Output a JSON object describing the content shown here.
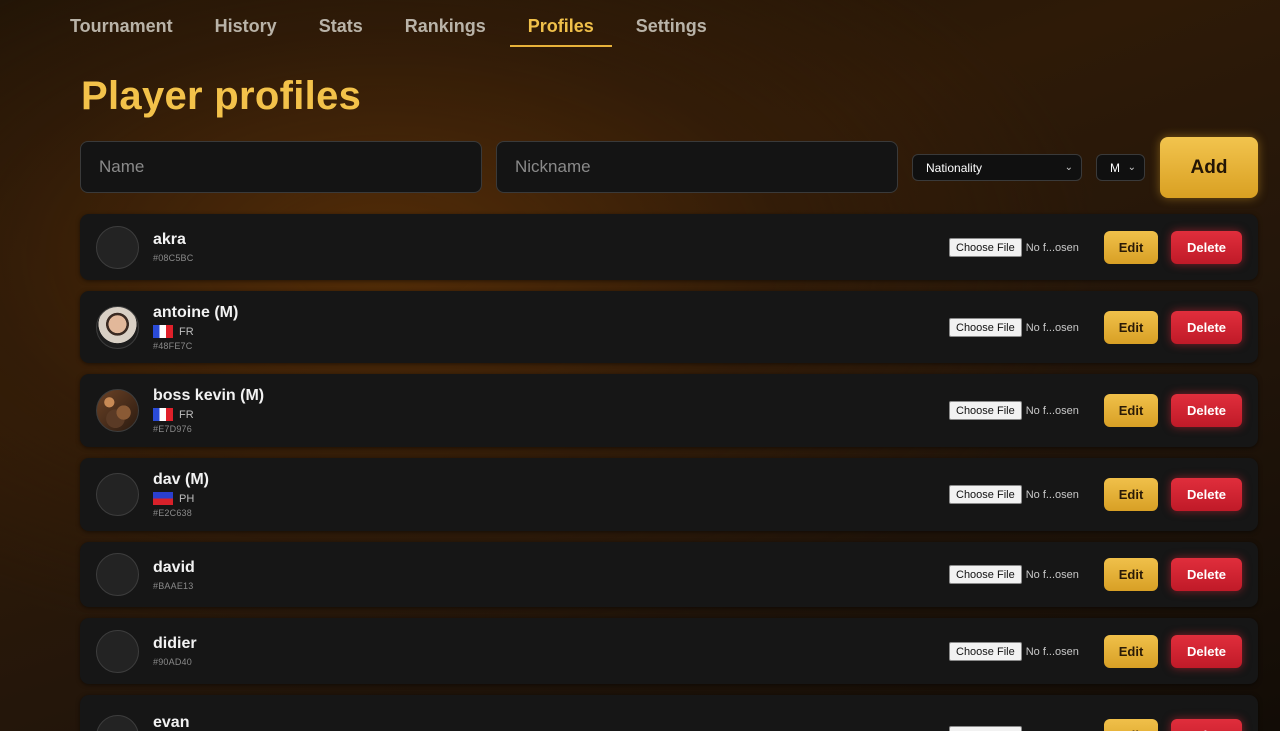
{
  "nav": {
    "tabs": [
      {
        "label": "Tournament"
      },
      {
        "label": "History"
      },
      {
        "label": "Stats"
      },
      {
        "label": "Rankings"
      },
      {
        "label": "Profiles",
        "active": true
      },
      {
        "label": "Settings"
      }
    ]
  },
  "page": {
    "title": "Player profiles"
  },
  "form": {
    "name_placeholder": "Name",
    "nickname_placeholder": "Nickname",
    "nationality_selected": "Nationality",
    "gender_selected": "M",
    "add_label": "Add"
  },
  "labels": {
    "choose_file": "Choose File",
    "file_status": "No f...osen",
    "edit": "Edit",
    "delete": "Delete"
  },
  "players": [
    {
      "name": "akra",
      "nationality": "",
      "id": "#08C5BC",
      "avatar": "empty"
    },
    {
      "name": "antoine (M)",
      "nationality": "FR",
      "id": "#48FE7C",
      "avatar": "photo1"
    },
    {
      "name": "boss kevin (M)",
      "nationality": "FR",
      "id": "#E7D976",
      "avatar": "photo2"
    },
    {
      "name": "dav (M)",
      "nationality": "PH",
      "id": "#E2C638",
      "avatar": "empty"
    },
    {
      "name": "david",
      "nationality": "",
      "id": "#BAAE13",
      "avatar": "empty"
    },
    {
      "name": "didier",
      "nationality": "",
      "id": "#90AD40",
      "avatar": "empty"
    },
    {
      "name": "evan",
      "nationality": "",
      "id": "",
      "avatar": "empty"
    }
  ],
  "colors": {
    "accent": "#f0c04a",
    "danger": "#d8212e",
    "card": "#161616"
  }
}
